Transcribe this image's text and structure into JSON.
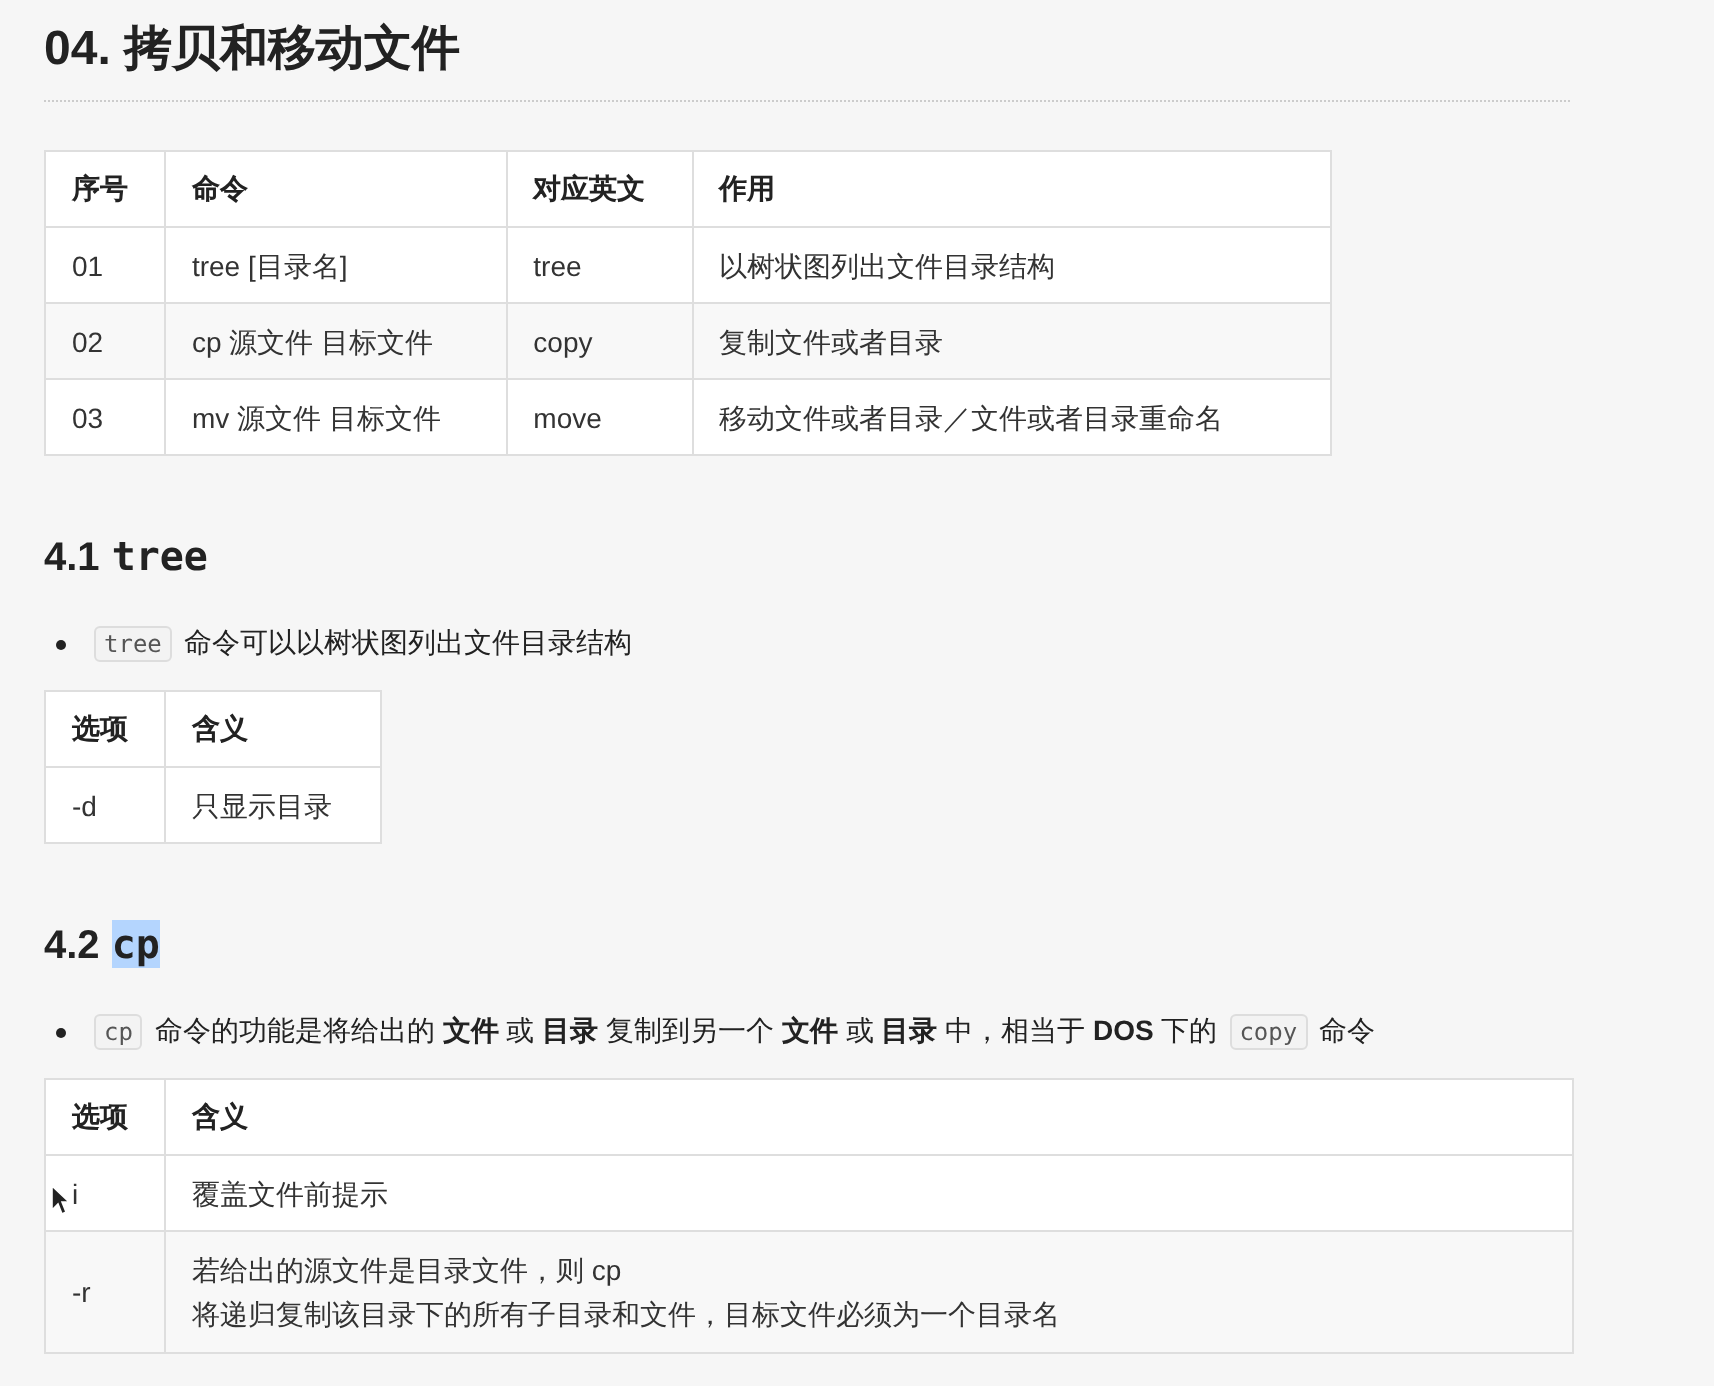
{
  "title": "04. 拷贝和移动文件",
  "commands_table": {
    "columns": [
      "序号",
      "命令",
      "对应英文",
      "作用"
    ],
    "rows": [
      [
        "01",
        "tree [目录名]",
        "tree",
        "以树状图列出文件目录结构"
      ],
      [
        "02",
        "cp 源文件 目标文件",
        "copy",
        "复制文件或者目录"
      ],
      [
        "03",
        "mv 源文件 目标文件",
        "move",
        "移动文件或者目录／文件或者目录重命名"
      ]
    ]
  },
  "sections": [
    {
      "number": "4.1",
      "command": "tree",
      "highlighted": false,
      "bullet": [
        {
          "kind": "code",
          "text": "tree"
        },
        {
          "kind": "text",
          "text": "命令可以以树状图列出文件目录结构"
        }
      ],
      "options_table": {
        "columns": [
          "选项",
          "含义"
        ],
        "rows": [
          {
            "option": "-d",
            "meaning": [
              "只显示目录"
            ],
            "pointer": false
          }
        ]
      }
    },
    {
      "number": "4.2",
      "command": "cp",
      "highlighted": true,
      "bullet": [
        {
          "kind": "code",
          "text": "cp"
        },
        {
          "kind": "text",
          "text": "命令的功能是将给出的 **文件** 或 **目录** 复制到另一个 **文件** 或 **目录** 中，相当于 **DOS** 下的"
        },
        {
          "kind": "code",
          "text": "copy"
        },
        {
          "kind": "text",
          "text": "命令"
        }
      ],
      "options_table": {
        "columns": [
          "选项",
          "含义"
        ],
        "rows": [
          {
            "option": "i",
            "meaning": [
              "覆盖文件前提示"
            ],
            "pointer": true
          },
          {
            "option": "-r",
            "meaning": [
              "若给出的源文件是目录文件，则 cp",
              "将递归复制该目录下的所有子目录和文件，目标文件必须为一个目录名"
            ],
            "pointer": false
          }
        ]
      }
    }
  ]
}
